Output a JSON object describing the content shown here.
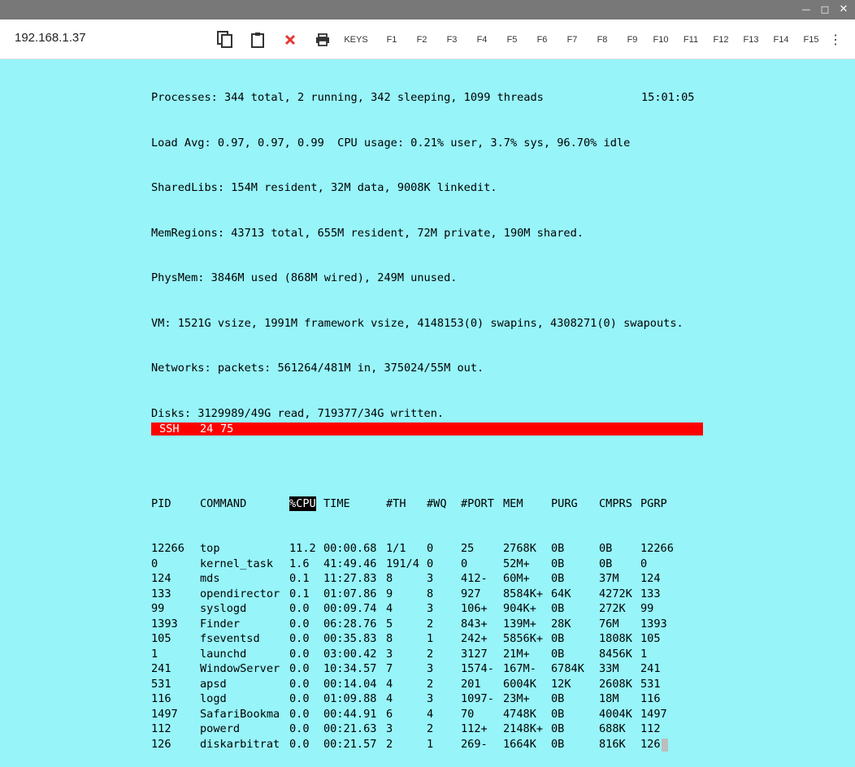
{
  "window": {
    "minimize_icon": "minimize-icon",
    "maximize_icon": "maximize-icon",
    "close_icon": "close-icon"
  },
  "toolbar": {
    "host": "192.168.1.37",
    "keys_label": "KEYS",
    "fkeys": [
      "F1",
      "F2",
      "F3",
      "F4",
      "F5",
      "F6",
      "F7",
      "F8",
      "F9",
      "F10",
      "F11",
      "F12",
      "F13",
      "F14",
      "F15"
    ],
    "close_color": "#e53935"
  },
  "summary": {
    "processes": "Processes: 344 total, 2 running, 342 sleeping, 1099 threads",
    "clock": "15:01:05",
    "load": "Load Avg: 0.97, 0.97, 0.99  CPU usage: 0.21% user, 3.7% sys, 96.70% idle",
    "sharedlibs": "SharedLibs: 154M resident, 32M data, 9008K linkedit.",
    "memregions": "MemRegions: 43713 total, 655M resident, 72M private, 190M shared.",
    "physmem": "PhysMem: 3846M used (868M wired), 249M unused.",
    "vm": "VM: 1521G vsize, 1991M framework vsize, 4148153(0) swapins, 4308271(0) swapouts.",
    "networks": "Networks: packets: 561264/481M in, 375024/55M out.",
    "disks": "Disks: 3129989/49G read, 719377/34G written."
  },
  "table": {
    "headers": [
      "PID",
      "COMMAND",
      "%CPU",
      "TIME",
      "#TH",
      "#WQ",
      "#PORT",
      "MEM",
      "PURG",
      "CMPRS",
      "PGRP"
    ],
    "rows": [
      [
        "12266",
        "top",
        "11.2",
        "00:00.68",
        "1/1",
        "0",
        "25",
        "2768K",
        "0B",
        "0B",
        "12266"
      ],
      [
        "0",
        "kernel_task",
        "1.6",
        "41:49.46",
        "191/4",
        "0",
        "0",
        "52M+",
        "0B",
        "0B",
        "0"
      ],
      [
        "124",
        "mds",
        "0.1",
        "11:27.83",
        "8",
        "3",
        "412-",
        "60M+",
        "0B",
        "37M",
        "124"
      ],
      [
        "133",
        "opendirector",
        "0.1",
        "01:07.86",
        "9",
        "8",
        "927",
        "8584K+",
        "64K",
        "4272K",
        "133"
      ],
      [
        "99",
        "syslogd",
        "0.0",
        "00:09.74",
        "4",
        "3",
        "106+",
        "904K+",
        "0B",
        "272K",
        "99"
      ],
      [
        "1393",
        "Finder",
        "0.0",
        "06:28.76",
        "5",
        "2",
        "843+",
        "139M+",
        "28K",
        "76M",
        "1393"
      ],
      [
        "105",
        "fseventsd",
        "0.0",
        "00:35.83",
        "8",
        "1",
        "242+",
        "5856K+",
        "0B",
        "1808K",
        "105"
      ],
      [
        "1",
        "launchd",
        "0.0",
        "03:00.42",
        "3",
        "2",
        "3127",
        "21M+",
        "0B",
        "8456K",
        "1"
      ],
      [
        "241",
        "WindowServer",
        "0.0",
        "10:34.57",
        "7",
        "3",
        "1574-",
        "167M-",
        "6784K",
        "33M",
        "241"
      ],
      [
        "531",
        "apsd",
        "0.0",
        "00:14.04",
        "4",
        "2",
        "201",
        "6004K",
        "12K",
        "2608K",
        "531"
      ],
      [
        "116",
        "logd",
        "0.0",
        "01:09.88",
        "4",
        "3",
        "1097-",
        "23M+",
        "0B",
        "18M",
        "116"
      ],
      [
        "1497",
        "SafariBookma",
        "0.0",
        "00:44.91",
        "6",
        "4",
        "70",
        "4748K",
        "0B",
        "4004K",
        "1497"
      ],
      [
        "112",
        "powerd",
        "0.0",
        "00:21.63",
        "3",
        "2",
        "112+",
        "2148K+",
        "0B",
        "688K",
        "112"
      ],
      [
        "126",
        "diskarbitrat",
        "0.0",
        "00:21.57",
        "2",
        "1",
        "269-",
        "1664K",
        "0B",
        "816K",
        "126"
      ]
    ]
  },
  "status": {
    "mode": "SSH",
    "rows": "24",
    "cols": "75"
  }
}
